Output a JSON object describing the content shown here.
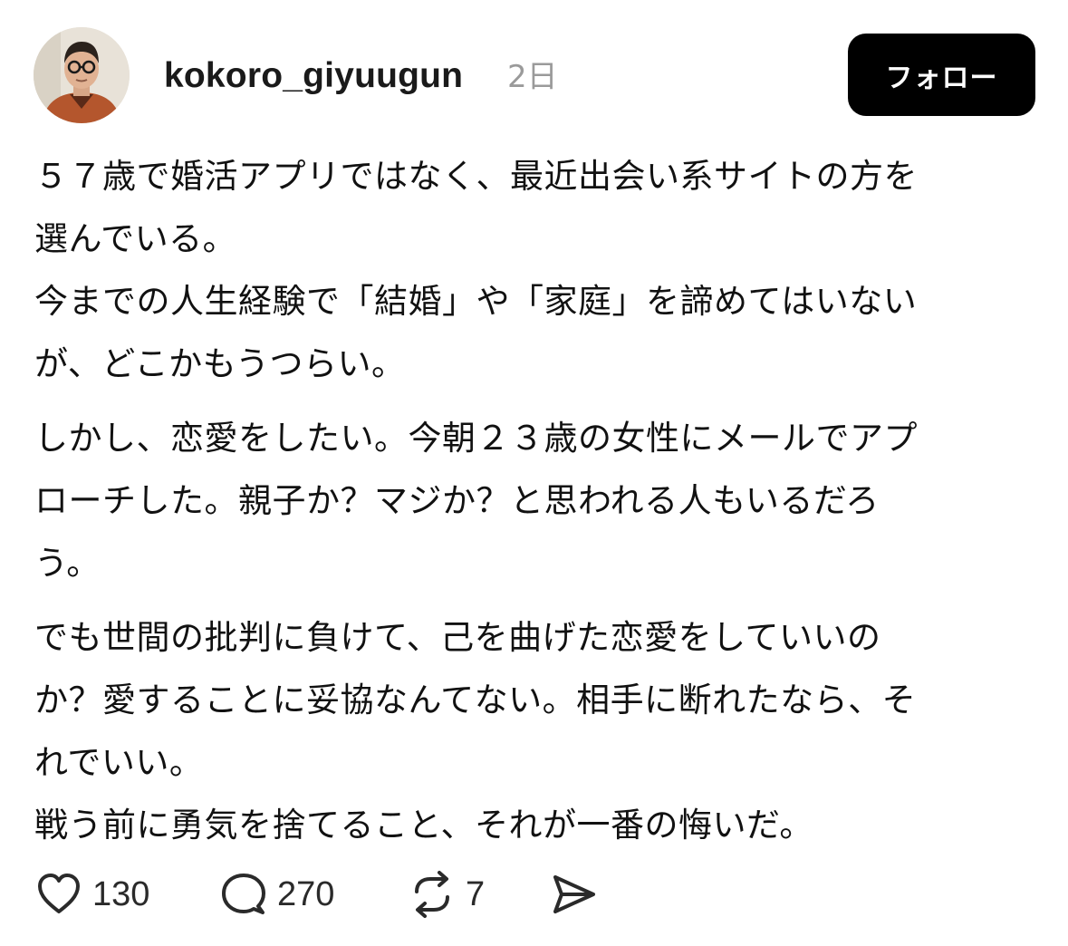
{
  "post": {
    "username": "kokoro_giyuugun",
    "time": "2日",
    "follow_label": "フォロー",
    "paragraphs": [
      [
        "５７歳で婚活アプリではなく、最近出会い系サイトの方を",
        "選んでいる。",
        "今までの人生経験で「結婚」や「家庭」を諦めてはいない",
        "が、どこかもうつらい。"
      ],
      [
        "しかし、恋愛をしたい。今朝２３歳の女性にメールでアプ",
        "ローチした。親子か？マジか？と思われる人もいるだろ",
        "う。"
      ],
      [
        "でも世間の批判に負けて、己を曲げた恋愛をしていいの",
        "か？愛することに妥協なんてない。相手に断れたなら、そ",
        "れでいい。",
        "戦う前に勇気を捨てること、それが一番の悔いだ。"
      ]
    ],
    "actions": {
      "like_count": "130",
      "reply_count": "270",
      "repost_count": "7"
    }
  },
  "icons": {
    "like": "heart-icon",
    "reply": "speech-bubble-icon",
    "repost": "repost-icon",
    "share": "send-icon"
  },
  "colors": {
    "follow_button_bg": "#000000",
    "follow_button_text": "#ffffff",
    "timestamp": "#9a9a9a",
    "text": "#111111"
  }
}
